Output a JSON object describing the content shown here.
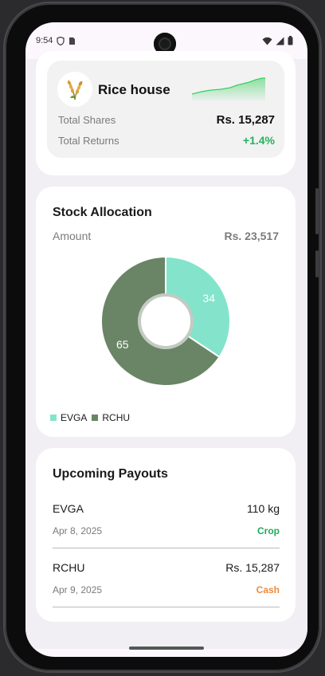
{
  "status_bar": {
    "time": "9:54"
  },
  "holding": {
    "name": "Rice house",
    "total_shares_label": "Total Shares",
    "total_shares_value": "Rs. 15,287",
    "total_returns_label": "Total Returns",
    "total_returns_value": "+1.4%",
    "sparkline_color": "#3ad05f"
  },
  "allocation": {
    "title": "Stock Allocation",
    "amount_label": "Amount",
    "amount_value": "Rs. 23,517",
    "chart_data": {
      "type": "pie",
      "categories": [
        "EVGA",
        "RCHU"
      ],
      "values": [
        34,
        65
      ],
      "colors": [
        "#83e4cb",
        "#6a8566"
      ],
      "donut": true
    }
  },
  "payouts": {
    "title": "Upcoming Payouts",
    "items": [
      {
        "name": "EVGA",
        "amount": "110 kg",
        "date": "Apr 8, 2025",
        "type": "Crop"
      },
      {
        "name": "RCHU",
        "amount": "Rs. 15,287",
        "date": "Apr 9, 2025",
        "type": "Cash"
      }
    ]
  }
}
